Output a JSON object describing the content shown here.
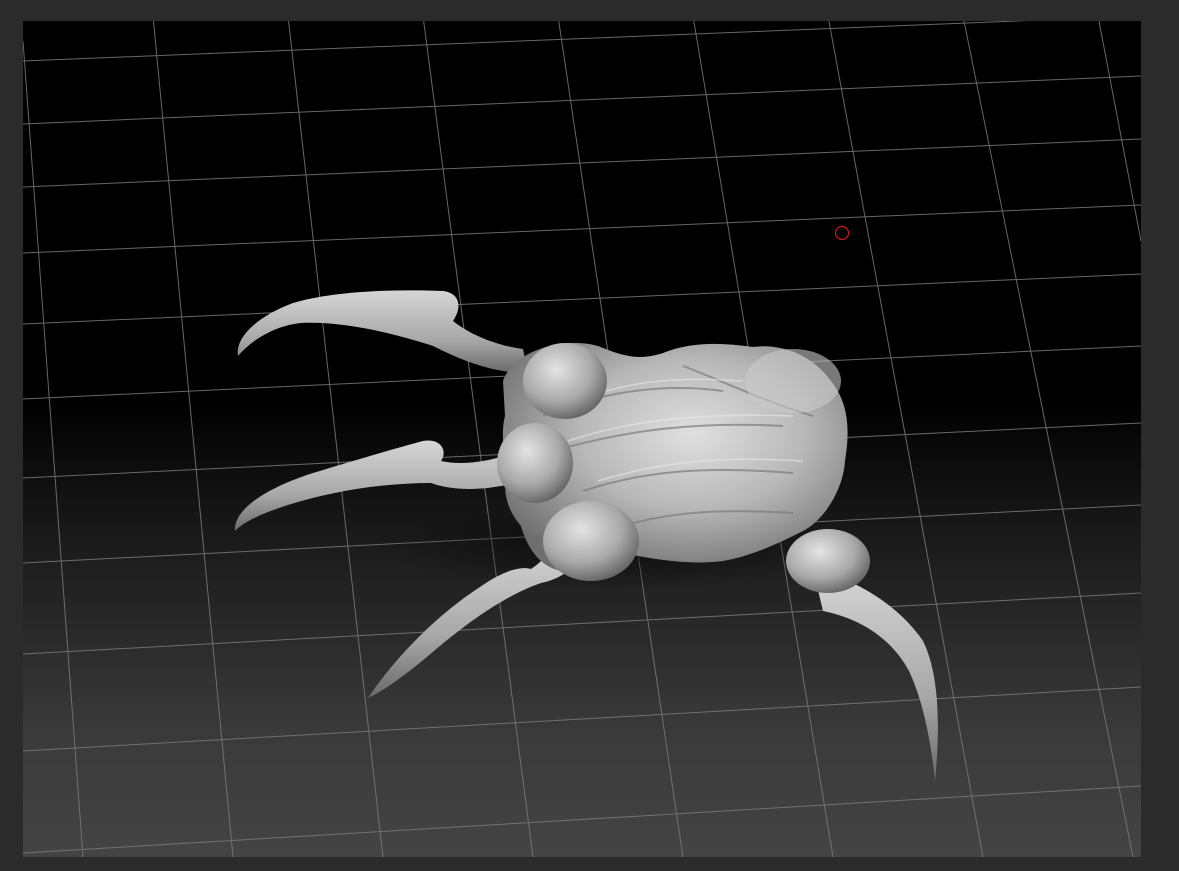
{
  "app": {
    "colors": {
      "frame": "#2b2b2b",
      "viewport_top": "#000000",
      "viewport_bottom": "#444444",
      "grid_line": "#7a7a7a",
      "model_fill": "#b4b4b4",
      "cursor_ring": "#d01818"
    }
  },
  "viewport": {
    "grid": true,
    "model": {
      "icon": "claw-creature-sculpt",
      "material": "matcap-gray"
    },
    "cursor": {
      "icon": "brush-cursor-ring"
    }
  }
}
